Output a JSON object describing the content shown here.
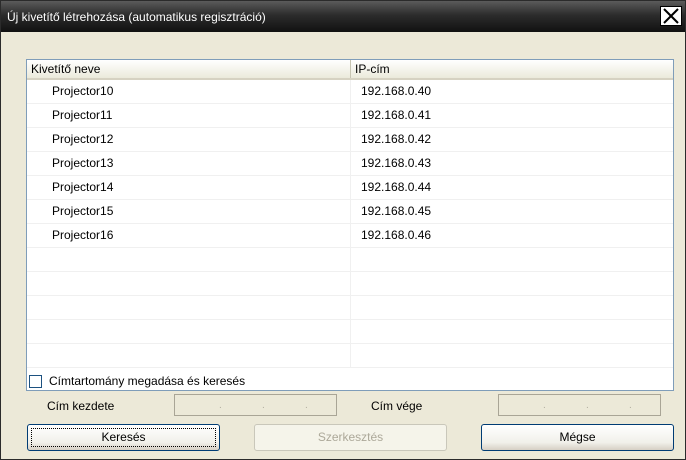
{
  "window": {
    "title": "Új kivetítő létrehozása (automatikus regisztráció)"
  },
  "list": {
    "columns": [
      "Kivetítő neve",
      "IP-cím"
    ],
    "rows": [
      [
        "Projector10",
        "192.168.0.40"
      ],
      [
        "Projector11",
        "192.168.0.41"
      ],
      [
        "Projector12",
        "192.168.0.42"
      ],
      [
        "Projector13",
        "192.168.0.43"
      ],
      [
        "Projector14",
        "192.168.0.44"
      ],
      [
        "Projector15",
        "192.168.0.45"
      ],
      [
        "Projector16",
        "192.168.0.46"
      ],
      [
        "",
        ""
      ],
      [
        "",
        ""
      ],
      [
        "",
        ""
      ],
      [
        "",
        ""
      ],
      [
        "",
        ""
      ]
    ]
  },
  "range": {
    "checkbox_label": "Címtartomány megadása és keresés",
    "checked": false,
    "start_label": "Cím kezdete",
    "end_label": "Cím vége"
  },
  "buttons": {
    "search": "Keresés",
    "edit": "Szerkesztés",
    "cancel": "Mégse"
  },
  "icons": {
    "close": "close-icon"
  }
}
